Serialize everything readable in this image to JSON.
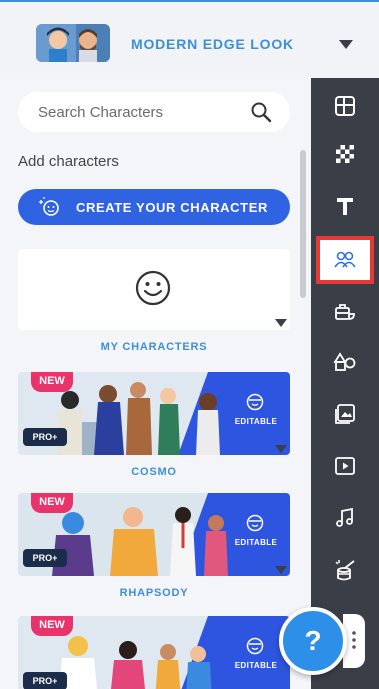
{
  "header": {
    "look_title": "MODERN EDGE LOOK"
  },
  "search": {
    "placeholder": "Search Characters"
  },
  "add_characters_label": "Add characters",
  "create_button_label": "CREATE YOUR CHARACTER",
  "my_characters_label": "MY CHARACTERS",
  "cards": [
    {
      "name": "COSMO",
      "badge_new": "NEW",
      "badge_pro": "PRO+",
      "editable": "EDITABLE"
    },
    {
      "name": "RHAPSODY",
      "badge_new": "NEW",
      "badge_pro": "PRO+",
      "editable": "EDITABLE"
    },
    {
      "name": "",
      "badge_new": "NEW",
      "badge_pro": "PRO+",
      "editable": "EDITABLE"
    }
  ],
  "toolbar": {
    "items": [
      {
        "icon": "layout-icon",
        "active": false
      },
      {
        "icon": "background-pattern-icon",
        "active": false
      },
      {
        "icon": "text-icon",
        "active": false
      },
      {
        "icon": "characters-icon",
        "active": true
      },
      {
        "icon": "props-icon",
        "active": false
      },
      {
        "icon": "shapes-icon",
        "active": false
      },
      {
        "icon": "images-icon",
        "active": false
      },
      {
        "icon": "video-icon",
        "active": false
      },
      {
        "icon": "music-icon",
        "active": false
      },
      {
        "icon": "effects-icon",
        "active": false
      }
    ]
  },
  "help": {
    "label": "?"
  },
  "colors": {
    "accent_blue": "#2f63e1",
    "label_blue": "#3f8ed7",
    "toolbar_dark": "#3a3e47",
    "new_badge": "#e8336b",
    "active_outline": "#e53935"
  }
}
